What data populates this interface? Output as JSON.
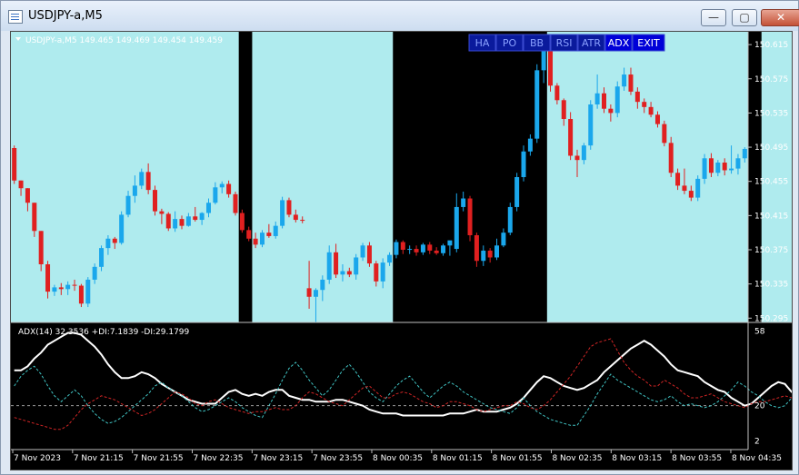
{
  "window": {
    "title": "USDJPY-a,M5",
    "minimize": "—",
    "maximize": "▢",
    "close": "✕"
  },
  "main_header": {
    "text": "USDJPY-a,M5  149.465 149.469 149.454 149.459"
  },
  "toolbar": {
    "buttons": [
      "HA",
      "PO",
      "BB",
      "RSI",
      "ATR",
      "ADX",
      "EXIT"
    ],
    "active": [
      "ADX",
      "EXIT"
    ]
  },
  "indicator_header": {
    "text": "ADX(14) 32.3536 +DI:7.1839 -DI:29.1799"
  },
  "colors": {
    "background": "#000000",
    "session_fill": "#afebee",
    "bull": "#1aa7ec",
    "bear": "#e02020",
    "adx": "#ffffff",
    "plus_di": "#40c4c4",
    "minus_di": "#d02525",
    "level": "#9a9a9a"
  },
  "chart_data": [
    {
      "type": "candlestick",
      "title": "USDJPY-a,M5",
      "ylim": [
        150.29,
        150.63
      ],
      "yticks": [
        "150.615",
        "150.575",
        "150.535",
        "150.495",
        "150.455",
        "150.415",
        "150.375",
        "150.335",
        "150.295"
      ],
      "shaded_regions": [
        [
          0,
          33
        ],
        [
          36,
          56
        ],
        [
          80,
          109
        ],
        [
          112,
          124
        ],
        [
          126,
          127
        ]
      ],
      "candles": [
        [
          150.494,
          150.497,
          150.452,
          150.456
        ],
        [
          150.456,
          150.456,
          150.438,
          150.447
        ],
        [
          150.447,
          150.447,
          150.42,
          150.43
        ],
        [
          150.43,
          150.43,
          150.39,
          150.397
        ],
        [
          150.397,
          150.397,
          150.35,
          150.358
        ],
        [
          150.358,
          150.362,
          150.318,
          150.326
        ],
        [
          150.326,
          150.334,
          150.321,
          150.331
        ],
        [
          150.331,
          150.336,
          150.322,
          150.329
        ],
        [
          150.329,
          150.338,
          150.322,
          150.334
        ],
        [
          150.334,
          150.34,
          150.327,
          150.333
        ],
        [
          150.333,
          150.335,
          150.308,
          150.312
        ],
        [
          150.312,
          150.343,
          150.308,
          150.34
        ],
        [
          150.34,
          150.359,
          150.335,
          150.355
        ],
        [
          150.355,
          150.38,
          150.35,
          150.377
        ],
        [
          150.377,
          150.392,
          150.369,
          150.388
        ],
        [
          150.388,
          150.39,
          150.376,
          150.383
        ],
        [
          150.383,
          150.42,
          150.381,
          150.416
        ],
        [
          150.416,
          150.444,
          150.413,
          150.438
        ],
        [
          150.438,
          150.462,
          150.43,
          150.45
        ],
        [
          150.45,
          150.47,
          150.446,
          150.466
        ],
        [
          150.466,
          150.476,
          150.44,
          150.445
        ],
        [
          150.445,
          150.45,
          150.415,
          150.42
        ],
        [
          150.42,
          150.423,
          150.405,
          150.417
        ],
        [
          150.417,
          150.419,
          150.397,
          150.4
        ],
        [
          150.4,
          150.42,
          150.396,
          150.411
        ],
        [
          150.411,
          150.415,
          150.399,
          150.403
        ],
        [
          150.403,
          150.418,
          150.402,
          150.414
        ],
        [
          150.414,
          150.425,
          150.408,
          150.41
        ],
        [
          150.41,
          150.419,
          150.404,
          150.418
        ],
        [
          150.418,
          150.435,
          150.413,
          150.43
        ],
        [
          150.43,
          150.454,
          150.428,
          150.448
        ],
        [
          150.448,
          150.455,
          150.441,
          150.452
        ],
        [
          150.452,
          150.456,
          150.436,
          150.44
        ],
        [
          150.44,
          150.443,
          150.415,
          150.418
        ],
        [
          150.418,
          150.422,
          150.395,
          150.398
        ],
        [
          150.398,
          150.402,
          150.385,
          150.388
        ],
        [
          150.388,
          150.395,
          150.377,
          150.381
        ],
        [
          150.381,
          150.398,
          150.378,
          150.395
        ],
        [
          150.395,
          150.405,
          150.389,
          150.391
        ],
        [
          150.391,
          150.408,
          150.388,
          150.403
        ],
        [
          150.403,
          150.437,
          150.4,
          150.433
        ],
        [
          150.433,
          150.436,
          150.413,
          150.416
        ],
        [
          150.416,
          150.422,
          150.407,
          150.41
        ],
        [
          150.41,
          150.414,
          150.406,
          150.409
        ],
        [
          150.33,
          150.362,
          150.306,
          150.32
        ],
        [
          150.32,
          150.33,
          150.29,
          150.328
        ],
        [
          150.328,
          150.345,
          150.315,
          150.34
        ],
        [
          150.34,
          150.38,
          150.335,
          150.372
        ],
        [
          150.372,
          150.382,
          150.342,
          150.346
        ],
        [
          150.346,
          150.358,
          150.338,
          150.35
        ],
        [
          150.35,
          150.354,
          150.343,
          150.346
        ],
        [
          150.346,
          150.37,
          150.34,
          150.366
        ],
        [
          150.366,
          150.383,
          150.362,
          150.38
        ],
        [
          150.38,
          150.384,
          150.355,
          150.359
        ],
        [
          150.359,
          150.362,
          150.332,
          150.338
        ],
        [
          150.338,
          150.365,
          150.33,
          150.36
        ],
        [
          150.36,
          150.372,
          150.356,
          150.369
        ],
        [
          150.369,
          150.387,
          150.365,
          150.384
        ],
        [
          150.384,
          150.386,
          150.37,
          150.375
        ],
        [
          150.375,
          150.38,
          150.37,
          150.376
        ],
        [
          150.376,
          150.38,
          150.368,
          150.372
        ],
        [
          150.372,
          150.383,
          150.369,
          150.381
        ],
        [
          150.381,
          150.384,
          150.37,
          150.374
        ],
        [
          150.374,
          150.378,
          150.369,
          150.371
        ],
        [
          150.371,
          150.382,
          150.368,
          150.38
        ],
        [
          150.38,
          150.384,
          150.368,
          150.386
        ],
        [
          150.376,
          150.441,
          150.372,
          150.425
        ],
        [
          150.425,
          150.443,
          150.42,
          150.435
        ],
        [
          150.435,
          150.438,
          150.385,
          150.392
        ],
        [
          150.392,
          150.395,
          150.355,
          150.362
        ],
        [
          150.362,
          150.38,
          150.356,
          150.374
        ],
        [
          150.374,
          150.377,
          150.36,
          150.366
        ],
        [
          150.366,
          150.388,
          150.363,
          150.38
        ],
        [
          150.38,
          150.4,
          150.378,
          150.395
        ],
        [
          150.395,
          150.43,
          150.392,
          150.425
        ],
        [
          150.425,
          150.465,
          150.42,
          150.46
        ],
        [
          150.46,
          150.497,
          150.455,
          150.49
        ],
        [
          150.49,
          150.51,
          150.485,
          150.505
        ],
        [
          150.505,
          150.592,
          150.5,
          150.585
        ],
        [
          150.585,
          150.62,
          150.57,
          150.612
        ],
        [
          150.612,
          150.615,
          150.56,
          150.567
        ],
        [
          150.567,
          150.57,
          150.545,
          150.55
        ],
        [
          150.55,
          150.552,
          150.52,
          150.528
        ],
        [
          150.528,
          150.536,
          150.48,
          150.485
        ],
        [
          150.485,
          150.492,
          150.46,
          150.48
        ],
        [
          150.48,
          150.5,
          150.475,
          150.497
        ],
        [
          150.497,
          150.55,
          150.492,
          150.545
        ],
        [
          150.545,
          150.58,
          150.54,
          150.558
        ],
        [
          150.558,
          150.565,
          150.535,
          150.54
        ],
        [
          150.54,
          150.545,
          150.525,
          150.535
        ],
        [
          150.535,
          150.572,
          150.53,
          150.566
        ],
        [
          150.566,
          150.588,
          150.561,
          150.58
        ],
        [
          150.58,
          150.588,
          150.556,
          150.56
        ],
        [
          150.56,
          150.565,
          150.54,
          150.548
        ],
        [
          150.548,
          150.552,
          150.535,
          150.542
        ],
        [
          150.542,
          150.548,
          150.53,
          150.533
        ],
        [
          150.533,
          150.537,
          150.518,
          150.522
        ],
        [
          150.522,
          150.526,
          150.496,
          150.5
        ],
        [
          150.5,
          150.507,
          150.46,
          150.465
        ],
        [
          150.465,
          150.47,
          150.445,
          150.45
        ],
        [
          150.45,
          150.47,
          150.44,
          150.444
        ],
        [
          150.444,
          150.45,
          150.432,
          150.436
        ],
        [
          150.436,
          150.462,
          150.432,
          150.458
        ],
        [
          150.458,
          150.487,
          150.452,
          150.482
        ],
        [
          150.482,
          150.488,
          150.46,
          150.465
        ],
        [
          150.465,
          150.48,
          150.461,
          150.477
        ],
        [
          150.477,
          150.482,
          150.462,
          150.468
        ],
        [
          150.468,
          150.497,
          150.464,
          150.47
        ],
        [
          150.47,
          150.487,
          150.463,
          150.482
        ],
        [
          150.482,
          150.495,
          150.477,
          150.493
        ]
      ],
      "x_labels": [
        "7 Nov 2023",
        "7 Nov 21:15",
        "7 Nov 21:55",
        "7 Nov 22:35",
        "7 Nov 23:15",
        "7 Nov 23:55",
        "8 Nov 00:35",
        "8 Nov 01:15",
        "8 Nov 01:55",
        "8 Nov 02:35",
        "8 Nov 03:15",
        "8 Nov 03:55",
        "8 Nov 04:35"
      ]
    },
    {
      "type": "line",
      "title": "ADX(14) 32.3536 +DI:7.1839 -DI:29.1799",
      "ylim": [
        0,
        60
      ],
      "yticks": [
        "58",
        "20",
        "2"
      ],
      "level": 20,
      "series": [
        {
          "name": "ADX(14)",
          "values": [
            38,
            38,
            40,
            44,
            47,
            51,
            53,
            55,
            57,
            57,
            56,
            53,
            50,
            46,
            41,
            37,
            34,
            34,
            35,
            37,
            36,
            34,
            31,
            29,
            27,
            25,
            23,
            22,
            21,
            21,
            21,
            24,
            27,
            28,
            26,
            25,
            26,
            25,
            27,
            28,
            28,
            25,
            24,
            23,
            23,
            22,
            22,
            22,
            23,
            23,
            22,
            21,
            20,
            18,
            17,
            16,
            16,
            16,
            15,
            15,
            15,
            15,
            15,
            15,
            15,
            16,
            16,
            16,
            17,
            18,
            17,
            17,
            17,
            18,
            19,
            21,
            24,
            28,
            32,
            35,
            34,
            32,
            30,
            29,
            28,
            29,
            31,
            33,
            37,
            40,
            43,
            46,
            49,
            51,
            53,
            51,
            48,
            45,
            41,
            38,
            37,
            36,
            35,
            32,
            30,
            28,
            27,
            24,
            22,
            20,
            21,
            24,
            27,
            30,
            32,
            31,
            27,
            24,
            23,
            22,
            21,
            22,
            20,
            20,
            19,
            18,
            18
          ]
        },
        {
          "name": "+DI",
          "values": [
            30,
            35,
            38,
            40,
            36,
            30,
            25,
            22,
            25,
            28,
            25,
            20,
            16,
            13,
            11,
            12,
            14,
            17,
            20,
            23,
            26,
            30,
            32,
            29,
            27,
            25,
            22,
            19,
            17,
            18,
            20,
            22,
            24,
            22,
            19,
            17,
            15,
            14,
            20,
            26,
            33,
            39,
            42,
            38,
            33,
            29,
            25,
            28,
            33,
            38,
            41,
            37,
            32,
            27,
            24,
            22,
            26,
            30,
            33,
            35,
            31,
            27,
            24,
            27,
            30,
            32,
            30,
            27,
            25,
            23,
            21,
            19,
            18,
            17,
            16,
            19,
            24,
            20,
            17,
            15,
            13,
            12,
            11,
            10,
            10,
            15,
            20,
            26,
            31,
            36,
            33,
            31,
            29,
            27,
            25,
            23,
            22,
            23,
            25,
            22,
            20,
            21,
            20,
            19,
            20,
            22,
            25,
            28,
            32,
            30,
            27,
            25,
            22,
            20,
            19,
            20,
            24,
            28,
            32,
            34,
            31,
            26,
            21,
            18,
            17,
            16,
            17
          ]
        },
        {
          "name": "-DI",
          "values": [
            14,
            13,
            12,
            11,
            10,
            9,
            8,
            8,
            10,
            14,
            18,
            21,
            23,
            25,
            24,
            23,
            21,
            19,
            17,
            15,
            16,
            18,
            21,
            24,
            27,
            26,
            24,
            21,
            20,
            22,
            23,
            21,
            19,
            18,
            17,
            16,
            17,
            17,
            18,
            19,
            18,
            18,
            20,
            24,
            27,
            26,
            24,
            22,
            21,
            20,
            23,
            26,
            29,
            30,
            27,
            24,
            24,
            26,
            27,
            26,
            24,
            22,
            21,
            19,
            20,
            22,
            22,
            21,
            20,
            18,
            17,
            18,
            19,
            20,
            20,
            22,
            21,
            19,
            18,
            20,
            23,
            27,
            31,
            35,
            40,
            45,
            50,
            52,
            53,
            54,
            48,
            42,
            38,
            35,
            33,
            30,
            30,
            33,
            31,
            29,
            26,
            24,
            24,
            25,
            26,
            24,
            22,
            21,
            20,
            19,
            21,
            22,
            22,
            23,
            24,
            25,
            24,
            24,
            23,
            23,
            22,
            20,
            18,
            17,
            17,
            18,
            18,
            18
          ]
        }
      ]
    }
  ]
}
